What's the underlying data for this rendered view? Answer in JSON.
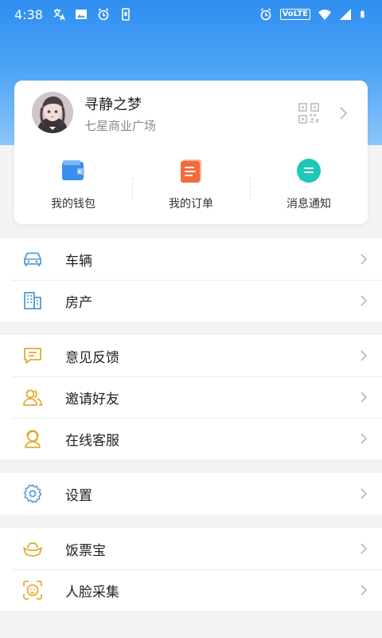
{
  "status_bar": {
    "time": "4:38",
    "network_badge": "VoLTE",
    "left_icons": [
      "translate-icon",
      "image-icon",
      "alarm-icon",
      "phone-storage-icon"
    ],
    "right_icons": [
      "alarm-icon",
      "volte-icon",
      "wifi-icon",
      "signal-icon",
      "battery-icon"
    ]
  },
  "profile": {
    "name": "寻静之梦",
    "location": "七星商业广场",
    "avatar_icon": "avatar-portrait",
    "qr_icon": "qr-code-icon"
  },
  "quick_actions": [
    {
      "label": "我的钱包",
      "icon": "wallet-icon",
      "color": "#3a8ef0"
    },
    {
      "label": "我的订单",
      "icon": "order-icon",
      "color": "#f26b3a"
    },
    {
      "label": "消息通知",
      "icon": "message-icon",
      "color": "#1fc8b4"
    }
  ],
  "menu_groups": [
    {
      "items": [
        {
          "label": "车辆",
          "icon": "car-icon"
        },
        {
          "label": "房产",
          "icon": "building-icon"
        }
      ]
    },
    {
      "items": [
        {
          "label": "意见反馈",
          "icon": "feedback-icon"
        },
        {
          "label": "邀请好友",
          "icon": "invite-friends-icon"
        },
        {
          "label": "在线客服",
          "icon": "customer-service-icon"
        }
      ]
    },
    {
      "items": [
        {
          "label": "设置",
          "icon": "settings-icon"
        }
      ]
    },
    {
      "items": [
        {
          "label": "饭票宝",
          "icon": "gold-ingot-icon"
        },
        {
          "label": "人脸采集",
          "icon": "face-scan-icon"
        }
      ]
    }
  ],
  "colors": {
    "header_blue": "#2f8ef0",
    "icon_blue": "#5b9bd5",
    "icon_gold": "#e2ad2e",
    "page_bg": "#f2f3f5"
  }
}
